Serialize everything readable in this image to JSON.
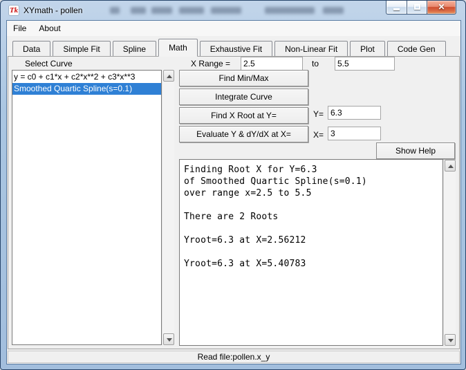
{
  "window": {
    "title": "XYmath - pollen",
    "app_logo_text": "Tk"
  },
  "icons": {
    "close_glyph": "✕"
  },
  "menu": {
    "items": [
      {
        "label": "File"
      },
      {
        "label": "About"
      }
    ]
  },
  "tabs": [
    {
      "label": "Data",
      "active": false
    },
    {
      "label": "Simple Fit",
      "active": false
    },
    {
      "label": "Spline",
      "active": false
    },
    {
      "label": "Math",
      "active": true
    },
    {
      "label": "Exhaustive Fit",
      "active": false
    },
    {
      "label": "Non-Linear Fit",
      "active": false
    },
    {
      "label": "Plot",
      "active": false
    },
    {
      "label": "Code Gen",
      "active": false
    }
  ],
  "curve_panel": {
    "label": "Select Curve",
    "curves": [
      {
        "label": "y = c0 + c1*x + c2*x**2 + c3*x**3",
        "selected": false
      },
      {
        "label": "Smoothed Quartic Spline(s=0.1)",
        "selected": true
      }
    ]
  },
  "x_range": {
    "label": "X Range =",
    "from_value": "2.5",
    "to_label": "to",
    "to_value": "5.5"
  },
  "actions": {
    "find_min_max": "Find Min/Max",
    "integrate_curve": "Integrate Curve",
    "find_x_root": "Find X Root at Y=",
    "evaluate": "Evaluate Y & dY/dX at X=",
    "show_help": "Show Help"
  },
  "fields": {
    "y_label": "Y=",
    "y_value": "6.3",
    "x_label": "X=",
    "x_value": "3"
  },
  "output": {
    "lines": [
      "Finding Root X for Y=6.3",
      "of Smoothed Quartic Spline(s=0.1)",
      "over range x=2.5 to 5.5",
      "",
      "There are 2 Roots",
      "",
      "Yroot=6.3 at X=2.56212",
      "",
      "Yroot=6.3 at X=5.40783"
    ]
  },
  "status": {
    "text": "Read file:pollen.x_y"
  },
  "colors": {
    "selection_blue": "#2f80d5",
    "frame_blue": "#aac6e2",
    "close_red": "#d2573a",
    "client_gray": "#f0f0f0"
  }
}
